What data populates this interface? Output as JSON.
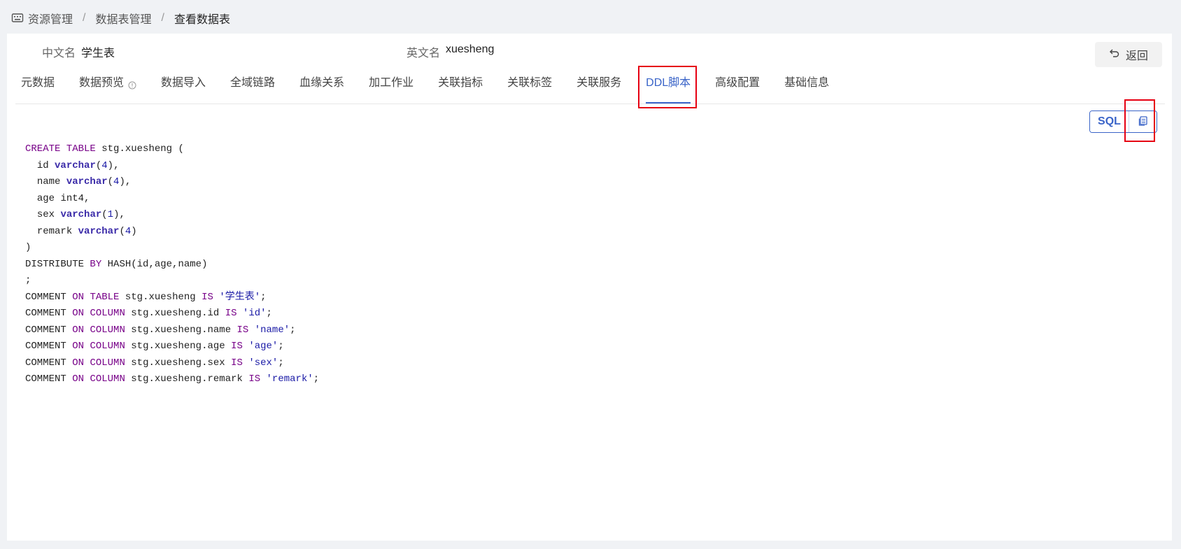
{
  "breadcrumb": {
    "items": [
      "资源管理",
      "数据表管理",
      "查看数据表"
    ],
    "separator": "/"
  },
  "info": {
    "cn_label": "中文名",
    "cn_value": "学生表",
    "en_label": "英文名",
    "en_value": "xuesheng"
  },
  "back_button": {
    "label": "返回"
  },
  "tabs": [
    {
      "label": "元数据"
    },
    {
      "label": "数据预览"
    },
    {
      "label": "数据导入"
    },
    {
      "label": "全域链路"
    },
    {
      "label": "血缘关系"
    },
    {
      "label": "加工作业"
    },
    {
      "label": "关联指标"
    },
    {
      "label": "关联标签"
    },
    {
      "label": "关联服务"
    },
    {
      "label": "DDL脚本"
    },
    {
      "label": "高级配置"
    },
    {
      "label": "基础信息"
    }
  ],
  "active_tab": "DDL脚本",
  "toolbar": {
    "sql_label": "SQL"
  },
  "code": {
    "keywords": {
      "create": "CREATE",
      "table": "TABLE",
      "distribute": "DISTRIBUTE",
      "by": "BY",
      "comment": "COMMENT",
      "on": "ON",
      "column": "COLUMN",
      "is": "IS",
      "varchar": "varchar"
    },
    "table_name": "stg.xuesheng",
    "columns": [
      {
        "name": "id",
        "type": "varchar",
        "size": "4",
        "comma": ","
      },
      {
        "name": "name",
        "type": "varchar",
        "size": "4",
        "comma": ","
      },
      {
        "name": "age",
        "plain_type": "int4",
        "comma": ","
      },
      {
        "name": "sex",
        "type": "varchar",
        "size": "1",
        "comma": ","
      },
      {
        "name": "remark",
        "type": "varchar",
        "size": "4",
        "comma": ""
      }
    ],
    "distribute_expr": "HASH(id,age,name)",
    "comments": [
      {
        "kind": "TABLE",
        "target": "stg.xuesheng",
        "text": "'学生表'"
      },
      {
        "kind": "COLUMN",
        "target": "stg.xuesheng.id",
        "text": "'id'"
      },
      {
        "kind": "COLUMN",
        "target": "stg.xuesheng.name",
        "text": "'name'"
      },
      {
        "kind": "COLUMN",
        "target": "stg.xuesheng.age",
        "text": "'age'"
      },
      {
        "kind": "COLUMN",
        "target": "stg.xuesheng.sex",
        "text": "'sex'"
      },
      {
        "kind": "COLUMN",
        "target": "stg.xuesheng.remark",
        "text": "'remark'"
      }
    ]
  },
  "colors": {
    "accent": "#3a64c8",
    "highlight": "#e60012",
    "keyword": "#770088",
    "string": "#1a1aa6"
  }
}
